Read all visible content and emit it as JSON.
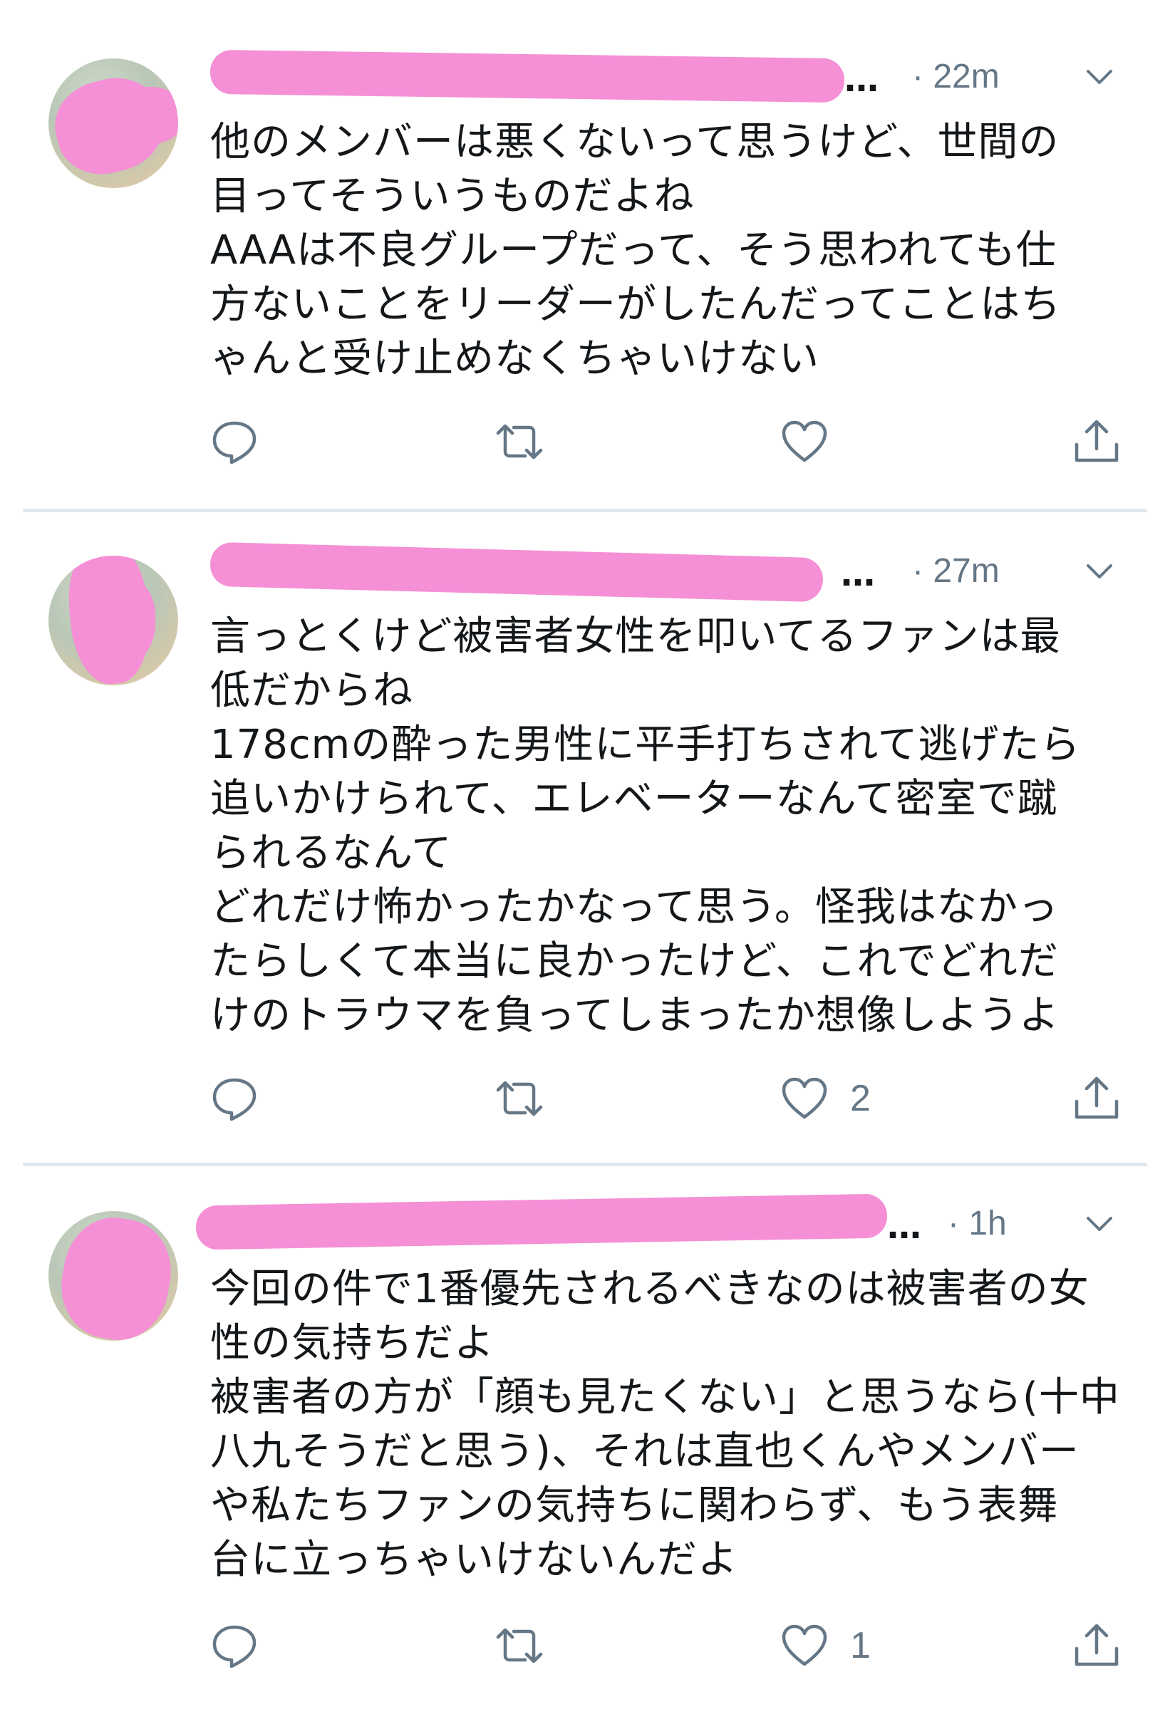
{
  "colors": {
    "text": "#14171a",
    "secondary": "#657786",
    "divider": "#e1e8ed",
    "redaction_pink": "#f58fd6"
  },
  "tweets": [
    {
      "name_fragment": "",
      "name_ellipsis": "…",
      "time": "· 22m",
      "text": "他のメンバーは悪くないって思うけど、世間の\n目ってそういうものだよね\nAAAは不良グループだって、そう思われても仕\n方ないことをリーダーがしたんだってことはち\nゃんと受け止めなくちゃいけない",
      "like_count": "",
      "icons": [
        "reply-icon",
        "retweet-icon",
        "like-icon",
        "share-icon"
      ]
    },
    {
      "name_fragment": "",
      "name_ellipsis": "…",
      "time": "· 27m",
      "text": "言っとくけど被害者女性を叩いてるファンは最\n低だからね\n178cmの酔った男性に平手打ちされて逃げたら\n追いかけられて、エレベーターなんて密室で蹴\nられるなんて\nどれだけ怖かったかなって思う。怪我はなかっ\nたらしくて本当に良かったけど、これでどれだ\nけのトラウマを負ってしまったか想像しようよ",
      "like_count": "2",
      "icons": [
        "reply-icon",
        "retweet-icon",
        "like-icon",
        "share-icon"
      ]
    },
    {
      "name_fragment": "",
      "name_ellipsis": "…",
      "time": "· 1h",
      "text": "今回の件で1番優先されるべきなのは被害者の女\n性の気持ちだよ\n被害者の方が「顔も見たくない」と思うなら(十中\n八九そうだと思う)、それは直也くんやメンバー\nや私たちファンの気持ちに関わらず、もう表舞\n台に立っちゃいけないんだよ",
      "like_count": "1",
      "icons": [
        "reply-icon",
        "retweet-icon",
        "like-icon",
        "share-icon"
      ]
    }
  ]
}
